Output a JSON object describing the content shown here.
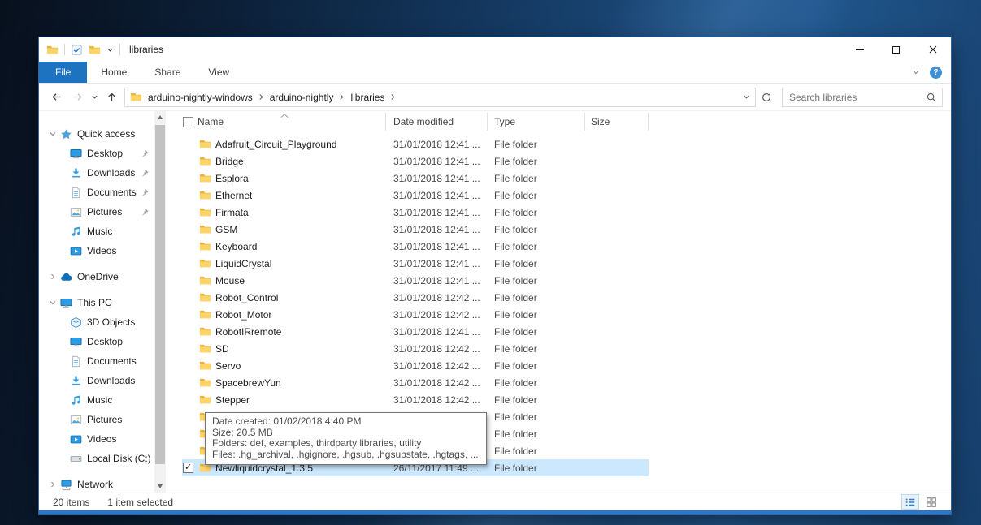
{
  "window": {
    "title": "libraries"
  },
  "ribbon": {
    "tabs": [
      {
        "label": "File"
      },
      {
        "label": "Home"
      },
      {
        "label": "Share"
      },
      {
        "label": "View"
      }
    ],
    "help_glyph": "?"
  },
  "navigation": {
    "breadcrumbs": [
      {
        "label": "arduino-nightly-windows"
      },
      {
        "label": "arduino-nightly"
      },
      {
        "label": "libraries"
      }
    ],
    "search_placeholder": "Search libraries"
  },
  "sidebar": {
    "items": [
      {
        "label": "Quick access"
      },
      {
        "label": "Desktop"
      },
      {
        "label": "Downloads"
      },
      {
        "label": "Documents"
      },
      {
        "label": "Pictures"
      },
      {
        "label": "Music"
      },
      {
        "label": "Videos"
      },
      {
        "label": "OneDrive"
      },
      {
        "label": "This PC"
      },
      {
        "label": "3D Objects"
      },
      {
        "label": "Desktop"
      },
      {
        "label": "Documents"
      },
      {
        "label": "Downloads"
      },
      {
        "label": "Music"
      },
      {
        "label": "Pictures"
      },
      {
        "label": "Videos"
      },
      {
        "label": "Local Disk (C:)"
      },
      {
        "label": "Network"
      }
    ]
  },
  "list": {
    "columns": [
      {
        "label": "Name"
      },
      {
        "label": "Date modified"
      },
      {
        "label": "Type"
      },
      {
        "label": "Size"
      }
    ],
    "rows": [
      {
        "name": "Adafruit_Circuit_Playground",
        "date": "31/01/2018 12:41 ...",
        "type": "File folder"
      },
      {
        "name": "Bridge",
        "date": "31/01/2018 12:41 ...",
        "type": "File folder"
      },
      {
        "name": "Esplora",
        "date": "31/01/2018 12:41 ...",
        "type": "File folder"
      },
      {
        "name": "Ethernet",
        "date": "31/01/2018 12:41 ...",
        "type": "File folder"
      },
      {
        "name": "Firmata",
        "date": "31/01/2018 12:41 ...",
        "type": "File folder"
      },
      {
        "name": "GSM",
        "date": "31/01/2018 12:41 ...",
        "type": "File folder"
      },
      {
        "name": "Keyboard",
        "date": "31/01/2018 12:41 ...",
        "type": "File folder"
      },
      {
        "name": "LiquidCrystal",
        "date": "31/01/2018 12:41 ...",
        "type": "File folder"
      },
      {
        "name": "Mouse",
        "date": "31/01/2018 12:41 ...",
        "type": "File folder"
      },
      {
        "name": "Robot_Control",
        "date": "31/01/2018 12:42 ...",
        "type": "File folder"
      },
      {
        "name": "Robot_Motor",
        "date": "31/01/2018 12:42 ...",
        "type": "File folder"
      },
      {
        "name": "RobotIRremote",
        "date": "31/01/2018 12:41 ...",
        "type": "File folder"
      },
      {
        "name": "SD",
        "date": "31/01/2018 12:42 ...",
        "type": "File folder"
      },
      {
        "name": "Servo",
        "date": "31/01/2018 12:42 ...",
        "type": "File folder"
      },
      {
        "name": "SpacebrewYun",
        "date": "31/01/2018 12:42 ...",
        "type": "File folder"
      },
      {
        "name": "Stepper",
        "date": "31/01/2018 12:42 ...",
        "type": "File folder"
      },
      {
        "name": "",
        "date": "",
        "type": "File folder"
      },
      {
        "name": "",
        "date": "",
        "type": "File folder"
      },
      {
        "name": "",
        "date": "",
        "type": "File folder"
      },
      {
        "name": "Newliquidcrystal_1.3.5",
        "date": "26/11/2017 11:49 ...",
        "type": "File folder",
        "selected": true
      }
    ]
  },
  "tooltip": {
    "lines": [
      "Date created: 01/02/2018 4:40 PM",
      "Size: 20.5 MB",
      "Folders: def, examples, thirdparty libraries, utility",
      "Files: .hg_archival, .hgignore, .hgsub, .hgsubstate, .hgtags, ..."
    ]
  },
  "statusbar": {
    "count": "20 items",
    "selection": "1 item selected"
  },
  "icons": {
    "selected_checkbox_glyph": "✓"
  }
}
